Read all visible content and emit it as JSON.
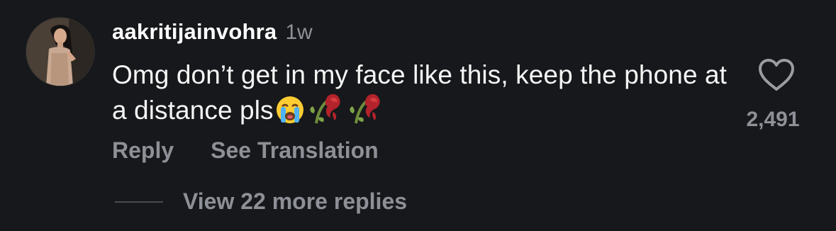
{
  "comment": {
    "username": "aakritijainvohra",
    "time": "1w",
    "text": "Omg don’t get in my face like this, keep the phone at a distance pls",
    "emojis": [
      "crying-face",
      "wilted-flower",
      "wilted-flower"
    ],
    "like_count": "2,491"
  },
  "actions": {
    "reply": "Reply",
    "see_translation": "See Translation"
  },
  "replies": {
    "view_more": "View 22 more replies"
  },
  "colors": {
    "background": "#17181b",
    "primary_text": "#ffffff",
    "secondary_text": "#8e9097"
  }
}
